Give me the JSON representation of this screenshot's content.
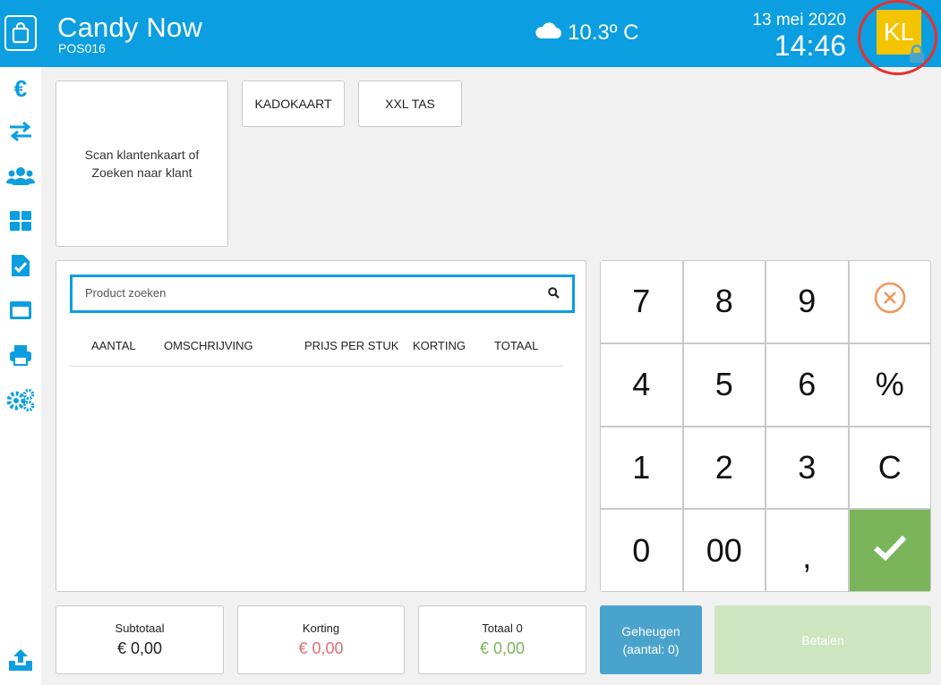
{
  "header": {
    "title": "Candy Now",
    "subtitle": "POS016",
    "temperature": "10.3º C",
    "date": "13 mei 2020",
    "time": "14:46",
    "user_initials": "KL",
    "colors": {
      "bar": "#0b9ee0",
      "avatar": "#f5c400",
      "highlight_ring": "#e53030"
    }
  },
  "sidebar": {
    "items": [
      {
        "icon": "euro-icon",
        "glyph": "€"
      },
      {
        "icon": "transfer-arrows-icon"
      },
      {
        "icon": "users-icon"
      },
      {
        "icon": "grid-icon"
      },
      {
        "icon": "clipboard-check-icon"
      },
      {
        "icon": "window-icon"
      },
      {
        "icon": "printer-icon"
      },
      {
        "icon": "gears-icon"
      },
      {
        "icon": "upload-icon"
      }
    ]
  },
  "customer": {
    "prompt": "Scan klantenkaart of Zoeken naar klant"
  },
  "quick_buttons": [
    {
      "label": "KADOKAART"
    },
    {
      "label": "XXL TAS"
    }
  ],
  "search": {
    "placeholder": "Product zoeken",
    "value": ""
  },
  "order_table": {
    "columns": [
      "AANTAL",
      "OMSCHRIJVING",
      "PRIJS PER STUK",
      "KORTING",
      "TOTAAL"
    ],
    "rows": []
  },
  "keypad": {
    "keys": [
      "7",
      "8",
      "9",
      "cancel",
      "4",
      "5",
      "6",
      "%",
      "1",
      "2",
      "3",
      "C",
      "0",
      "00",
      ",",
      "confirm"
    ],
    "colors": {
      "cancel": "#f0965a",
      "confirm": "#7ab55c"
    }
  },
  "totals": {
    "subtotal": {
      "label": "Subtotaal",
      "value": "€ 0,00",
      "color": "#222222"
    },
    "discount": {
      "label": "Korting",
      "value": "€ 0,00",
      "color": "#e07070"
    },
    "total": {
      "label": "Totaal 0",
      "value": "€ 0,00",
      "color": "#7ab55c"
    }
  },
  "actions": {
    "memory_line1": "Geheugen",
    "memory_line2": "(aantal: 0)",
    "pay_label": "Betalen",
    "colors": {
      "memory": "#4aa3cc",
      "pay": "#cde5c1"
    }
  }
}
